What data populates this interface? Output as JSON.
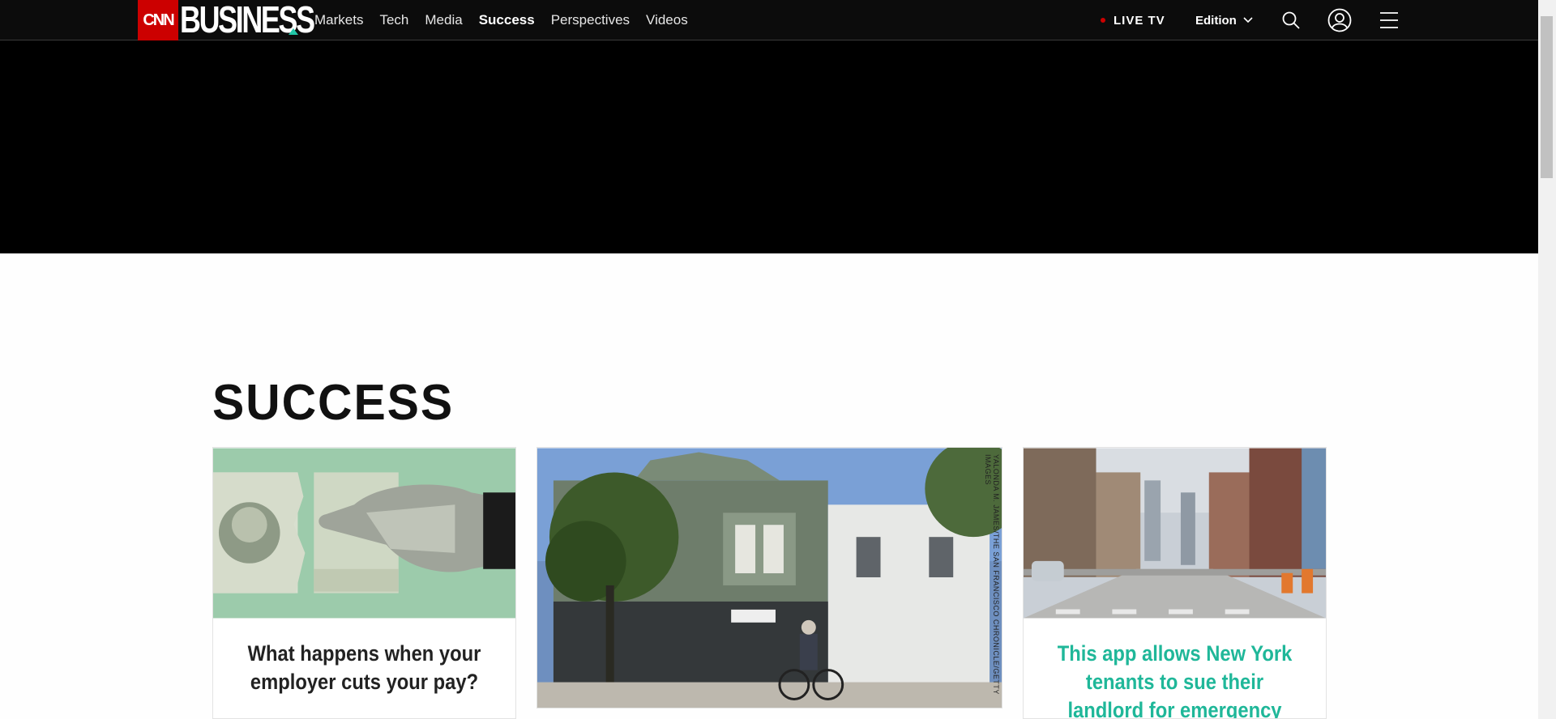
{
  "header": {
    "logo_cnn": "CNN",
    "logo_business": "BUSINESS",
    "nav": [
      {
        "label": "Markets",
        "active": false
      },
      {
        "label": "Tech",
        "active": false
      },
      {
        "label": "Media",
        "active": false
      },
      {
        "label": "Success",
        "active": true
      },
      {
        "label": "Perspectives",
        "active": false
      },
      {
        "label": "Videos",
        "active": false
      }
    ],
    "live_tv": "LIVE TV",
    "edition": "Edition",
    "icons": [
      "search-icon",
      "account-icon",
      "menu-icon"
    ]
  },
  "section": {
    "title": "SUCCESS"
  },
  "cards": [
    {
      "title": "What happens when your employer cuts your pay?",
      "image": "torn-dollar-bill-illustration",
      "title_color": "#222222"
    },
    {
      "title": "",
      "image": "street-building-cyclist-photo",
      "credit": "YALONDA M. JAMES/THE SAN FRANCISCO CHRONICLE/GETTY IMAGES"
    },
    {
      "title": "This app allows New York tenants to sue their landlord for emergency repairs",
      "image": "empty-new-york-street-photo",
      "title_color": "#1fb799"
    }
  ],
  "colors": {
    "nav_bg": "#0c0c0c",
    "cnn_red": "#cc0000",
    "accent_teal": "#22c7a8"
  }
}
